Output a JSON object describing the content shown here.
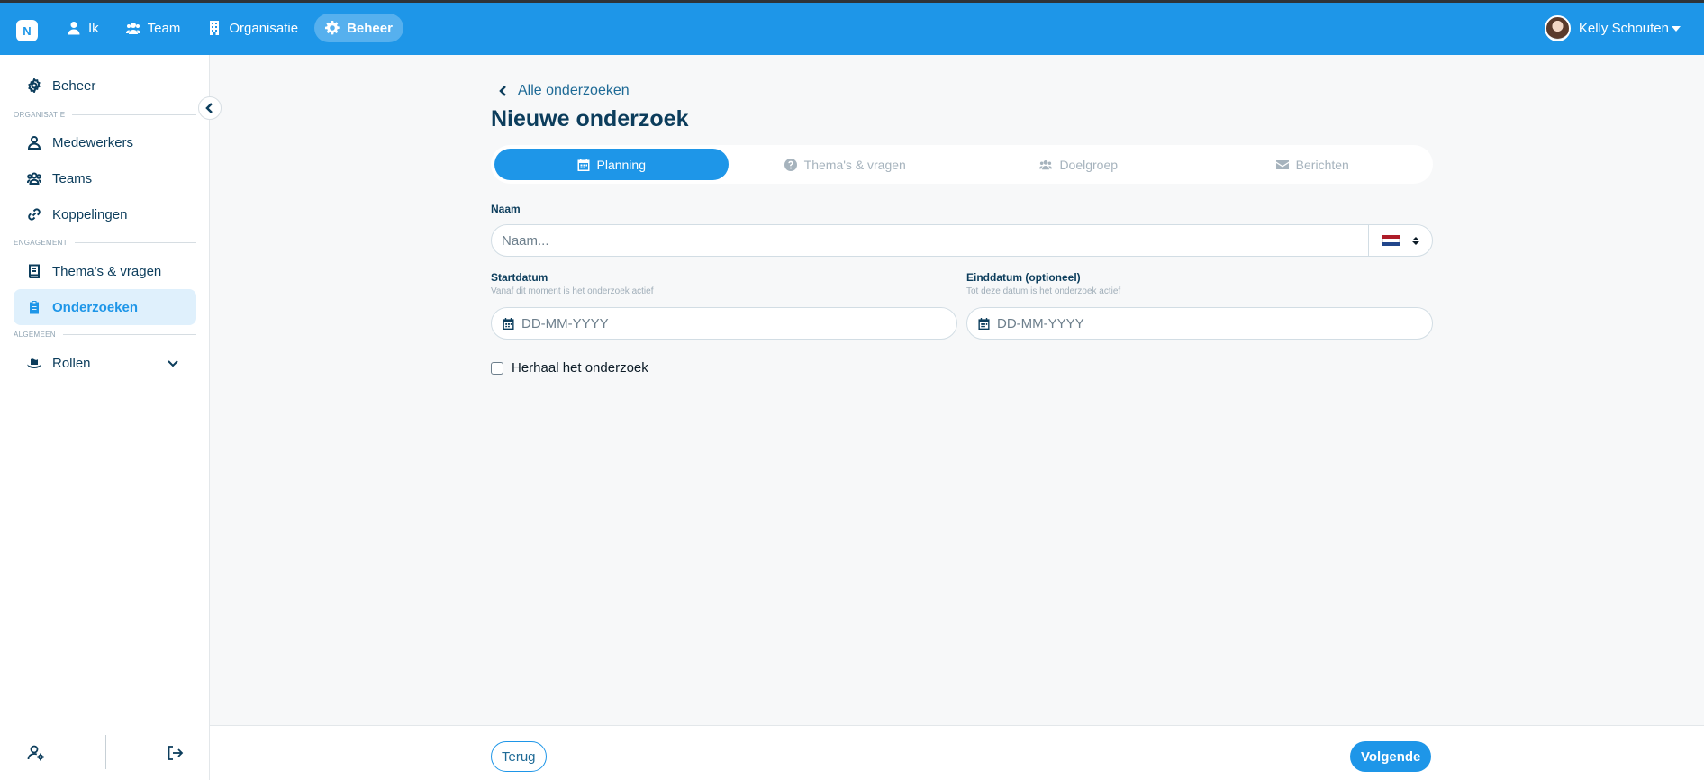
{
  "topbar": {
    "logo": "N",
    "nav": [
      {
        "label": "Ik",
        "icon": "user-icon"
      },
      {
        "label": "Team",
        "icon": "users-icon"
      },
      {
        "label": "Organisatie",
        "icon": "building-icon"
      },
      {
        "label": "Beheer",
        "icon": "gear-icon",
        "active": true
      }
    ],
    "user_name": "Kelly Schouten"
  },
  "sidebar": {
    "home": "Beheer",
    "section_organisatie": "ORGANISATIE",
    "medewerkers": "Medewerkers",
    "teams": "Teams",
    "koppelingen": "Koppelingen",
    "section_engagement": "ENGAGEMENT",
    "themas": "Thema's & vragen",
    "onderzoeken": "Onderzoeken",
    "section_algemeen": "ALGEMEEN",
    "rollen": "Rollen"
  },
  "main": {
    "back_link": "Alle onderzoeken",
    "title": "Nieuwe onderzoek",
    "tabs": [
      {
        "label": "Planning",
        "active": true
      },
      {
        "label": "Thema's & vragen"
      },
      {
        "label": "Doelgroep"
      },
      {
        "label": "Berichten"
      }
    ],
    "name_label": "Naam",
    "name_placeholder": "Naam...",
    "start_label": "Startdatum",
    "start_hint": "Vanaf dit moment is het onderzoek actief",
    "start_placeholder": "DD-MM-YYYY",
    "end_label": "Einddatum (optioneel)",
    "end_hint": "Tot deze datum is het onderzoek actief",
    "end_placeholder": "DD-MM-YYYY",
    "repeat_label": "Herhaal het onderzoek"
  },
  "footer": {
    "back_label": "Terug",
    "next_label": "Volgende"
  },
  "colors": {
    "primary": "#1e96e8",
    "text": "#0c3d5c",
    "active_bg": "#dff0fc"
  }
}
